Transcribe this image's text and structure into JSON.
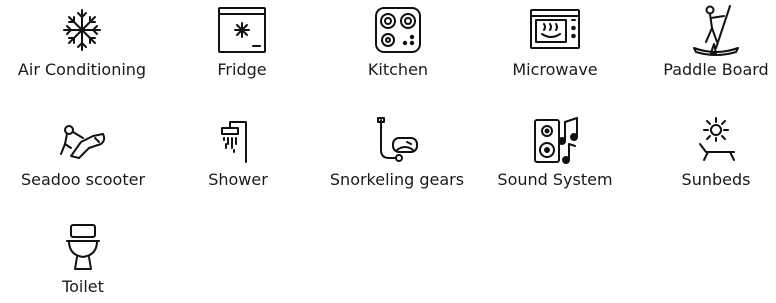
{
  "amenities": [
    {
      "label": "Air Conditioning",
      "icon": "snowflake-icon"
    },
    {
      "label": "Fridge",
      "icon": "fridge-icon"
    },
    {
      "label": "Kitchen",
      "icon": "stove-icon"
    },
    {
      "label": "Microwave",
      "icon": "microwave-icon"
    },
    {
      "label": "Paddle Board",
      "icon": "paddle-board-icon"
    },
    {
      "label": "Seadoo scooter",
      "icon": "sea-scooter-icon"
    },
    {
      "label": "Shower",
      "icon": "shower-icon"
    },
    {
      "label": "Snorkeling gears",
      "icon": "snorkel-icon"
    },
    {
      "label": "Sound System",
      "icon": "speaker-music-icon"
    },
    {
      "label": "Sunbeds",
      "icon": "sunbed-icon"
    },
    {
      "label": "Toilet",
      "icon": "toilet-icon"
    }
  ]
}
